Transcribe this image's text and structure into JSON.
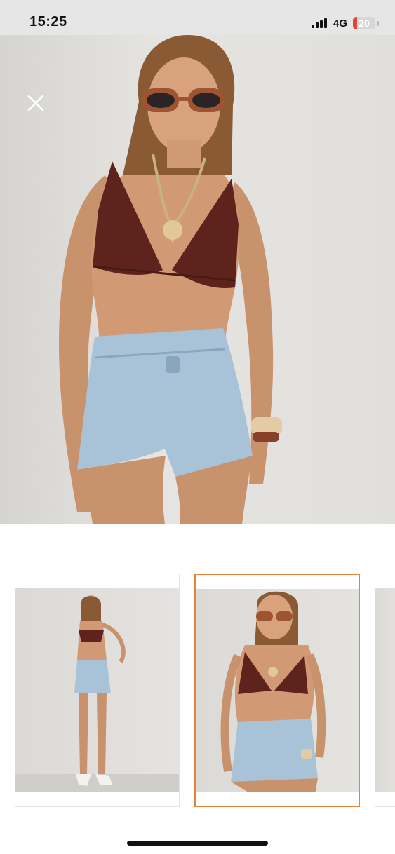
{
  "status_bar": {
    "time": "15:25",
    "network": "4G",
    "battery": "20",
    "battery_level": 0.2,
    "battery_color": "#e2463a"
  },
  "gallery": {
    "close_icon": "close-icon",
    "thumbnails": [
      {
        "name": "full-body-thumbnail",
        "selected": false
      },
      {
        "name": "close-up-thumbnail",
        "selected": true
      },
      {
        "name": "partial-thumbnail",
        "selected": false
      }
    ],
    "selected_border_color": "#e8823a"
  }
}
